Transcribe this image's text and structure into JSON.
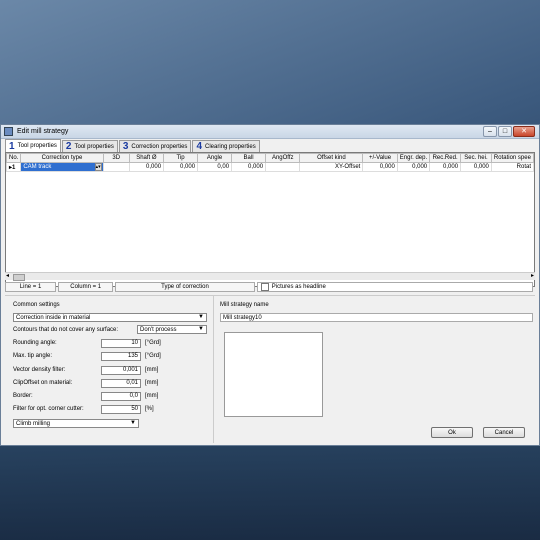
{
  "window": {
    "title": "Edit mill strategy"
  },
  "tabs": [
    {
      "num": "1",
      "label": "Tool properties"
    },
    {
      "num": "2",
      "label": "Tool properties"
    },
    {
      "num": "3",
      "label": "Correction properties"
    },
    {
      "num": "4",
      "label": "Clearing properties"
    }
  ],
  "grid": {
    "columns": [
      "No.",
      "Correction type",
      "3D",
      "Shaft Ø",
      "Tip",
      "Angle",
      "Ball",
      "AngOffz",
      "Offset kind",
      "+/-Value",
      "Engr. dep.",
      "Rec.Red.",
      "Sec. hei.",
      "Rotation spee"
    ],
    "rows": [
      {
        "no": "1",
        "correction_type": "CAM track",
        "threed": "",
        "shaft": "0,000",
        "tip": "0,000",
        "angle": "0,00",
        "ball": "0,000",
        "angoffz": "",
        "offset_kind": "XY-Offset",
        "value": "0,000",
        "engr_dep": "0,000",
        "rec_red": "0,000",
        "sec_hei": "0,000",
        "rotation": "Rotat"
      }
    ]
  },
  "status": {
    "line": "Line = 1",
    "column": "Column = 1",
    "type": "Type of correction",
    "pictures": "Pictures as headline"
  },
  "common": {
    "heading": "Common settings",
    "correction_mode": "Correction inside in material",
    "contours_label": "Contours that do not cover any surface:",
    "contours_value": "Don't process",
    "rounding_label": "Rounding angle:",
    "rounding_value": "10",
    "rounding_unit": "[°Grd]",
    "max_tip_label": "Max. tip angle:",
    "max_tip_value": "135",
    "max_tip_unit": "[°Grd]",
    "vector_label": "Vector density filter:",
    "vector_value": "0,001",
    "vector_unit": "[mm]",
    "clip_label": "ClipOffset on material:",
    "clip_value": "0,01",
    "clip_unit": "[mm]",
    "border_label": "Border:",
    "border_value": "0,0",
    "border_unit": "[mm]",
    "filter_label": "Filter for opt. corner cutter:",
    "filter_value": "50",
    "filter_unit": "[%]",
    "milling_mode": "Climb milling"
  },
  "strategy": {
    "name_label": "Mill strategy name",
    "name_value": "Mill strategy10"
  },
  "buttons": {
    "ok": "Ok",
    "cancel": "Cancel"
  }
}
